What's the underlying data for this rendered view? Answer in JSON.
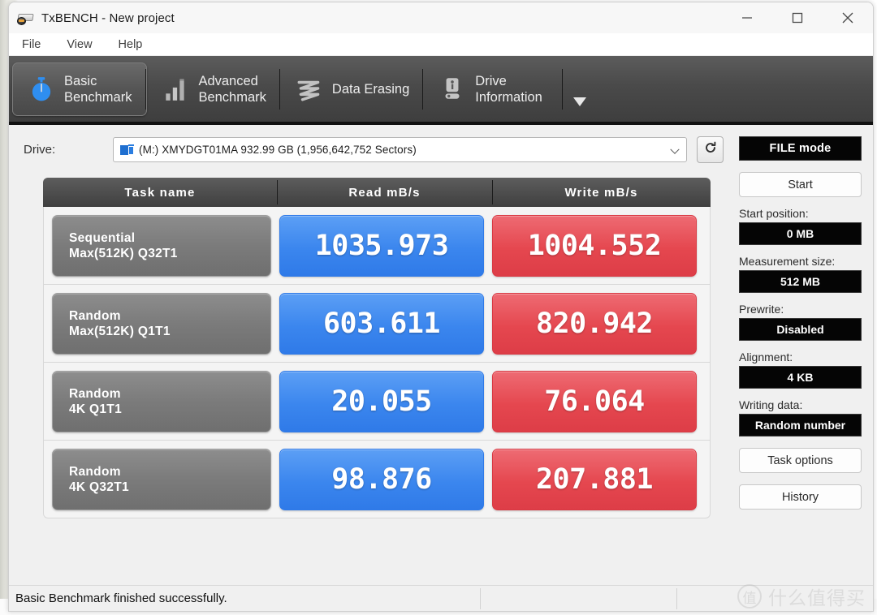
{
  "window": {
    "title": "TxBENCH - New project",
    "app_icon": "disk-drive-icon",
    "minimize": "minimize-icon",
    "maximize": "maximize-icon",
    "close": "close-icon"
  },
  "menubar": {
    "items": [
      {
        "label": "File"
      },
      {
        "label": "View"
      },
      {
        "label": "Help"
      }
    ]
  },
  "tabs": [
    {
      "label": "Basic\nBenchmark",
      "icon": "stopwatch-icon",
      "active": true
    },
    {
      "label": "Advanced\nBenchmark",
      "icon": "bar-chart-icon",
      "active": false
    },
    {
      "label": "Data Erasing",
      "icon": "zigzag-erase-icon",
      "active": false
    },
    {
      "label": "Drive\nInformation",
      "icon": "drive-info-icon",
      "active": false
    }
  ],
  "tab_overflow_icon": "chevron-down-icon",
  "drive": {
    "label": "Drive:",
    "selected": "(M:) XMYDGT01MA  932.99 GB (1,956,642,752 Sectors)",
    "icon": "hard-drive-icon",
    "dropdown_icon": "chevron-down-icon",
    "refresh_icon": "refresh-icon"
  },
  "table": {
    "headers": [
      "Task name",
      "Read mB/s",
      "Write mB/s"
    ],
    "rows": [
      {
        "task_line1": "Sequential",
        "task_line2": "Max(512K) Q32T1",
        "read": "1035.973",
        "write": "1004.552"
      },
      {
        "task_line1": "Random",
        "task_line2": "Max(512K) Q1T1",
        "read": "603.611",
        "write": "820.942"
      },
      {
        "task_line1": "Random",
        "task_line2": "4K Q1T1",
        "read": "20.055",
        "write": "76.064"
      },
      {
        "task_line1": "Random",
        "task_line2": "4K Q32T1",
        "read": "98.876",
        "write": "207.881"
      }
    ]
  },
  "sidepanel": {
    "mode_button": "FILE mode",
    "start_button": "Start",
    "fields": [
      {
        "label": "Start position:",
        "value": "0 MB"
      },
      {
        "label": "Measurement size:",
        "value": "512 MB"
      },
      {
        "label": "Prewrite:",
        "value": "Disabled"
      },
      {
        "label": "Alignment:",
        "value": "4 KB"
      },
      {
        "label": "Writing data:",
        "value": "Random number"
      }
    ],
    "task_options_button": "Task options",
    "history_button": "History"
  },
  "statusbar": {
    "message": "Basic Benchmark finished successfully."
  },
  "watermark": {
    "badge": "值",
    "text": "什么值得买"
  },
  "colors": {
    "read_accent": "#3b86ee",
    "write_accent": "#e5474f",
    "tabstrip": "#4a4a4a",
    "task_cell": "#7b7b7b",
    "field_value_bg": "#050505"
  }
}
